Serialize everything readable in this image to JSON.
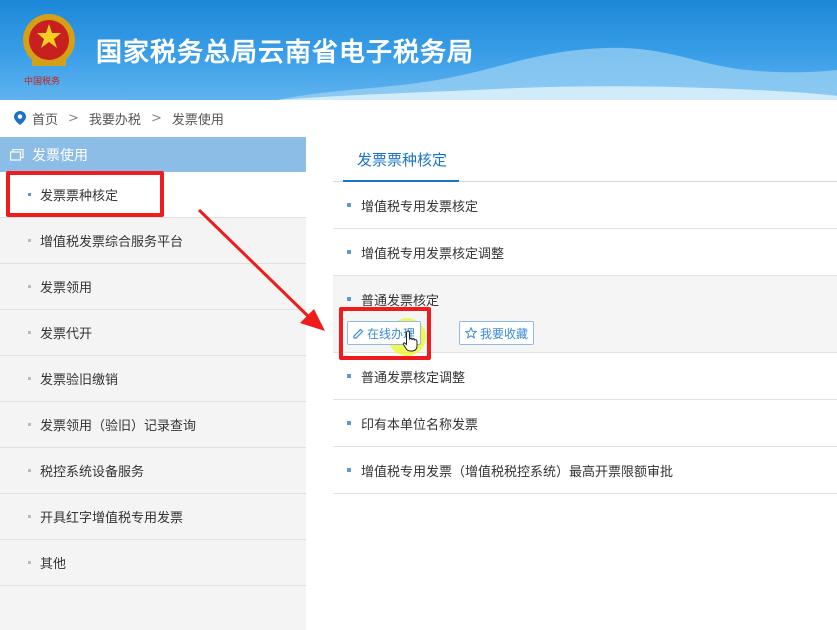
{
  "header": {
    "title": "国家税务总局云南省电子税务局"
  },
  "breadcrumb": {
    "home": "首页",
    "level2": "我要办税",
    "current": "发票使用"
  },
  "sidebar": {
    "heading": "发票使用",
    "items": [
      {
        "label": "发票票种核定"
      },
      {
        "label": "增值税发票综合服务平台"
      },
      {
        "label": "发票领用"
      },
      {
        "label": "发票代开"
      },
      {
        "label": "发票验旧缴销"
      },
      {
        "label": "发票领用（验旧）记录查询"
      },
      {
        "label": "税控系统设备服务"
      },
      {
        "label": "开具红字增值税专用发票"
      },
      {
        "label": "其他"
      }
    ]
  },
  "main": {
    "tab_title": "发票票种核定",
    "items": [
      {
        "label": "增值税专用发票核定"
      },
      {
        "label": "增值税专用发票核定调整"
      },
      {
        "label": "普通发票核定"
      },
      {
        "label": "普通发票核定调整"
      },
      {
        "label": "印有本单位名称发票"
      },
      {
        "label": "增值税专用发票（增值税税控系统）最高开票限额审批"
      }
    ],
    "actions": {
      "online": "在线办理",
      "favorite": "我要收藏"
    }
  },
  "colors": {
    "header_blue": "#1c87d8",
    "accent_blue": "#1a73c5",
    "highlight_red": "#ee1c1c",
    "sidebar_head": "#8cbde6"
  },
  "icons": [
    "emblem-icon",
    "location-pin-icon",
    "copy-icon",
    "edit-icon",
    "star-icon",
    "hand-cursor-icon"
  ]
}
